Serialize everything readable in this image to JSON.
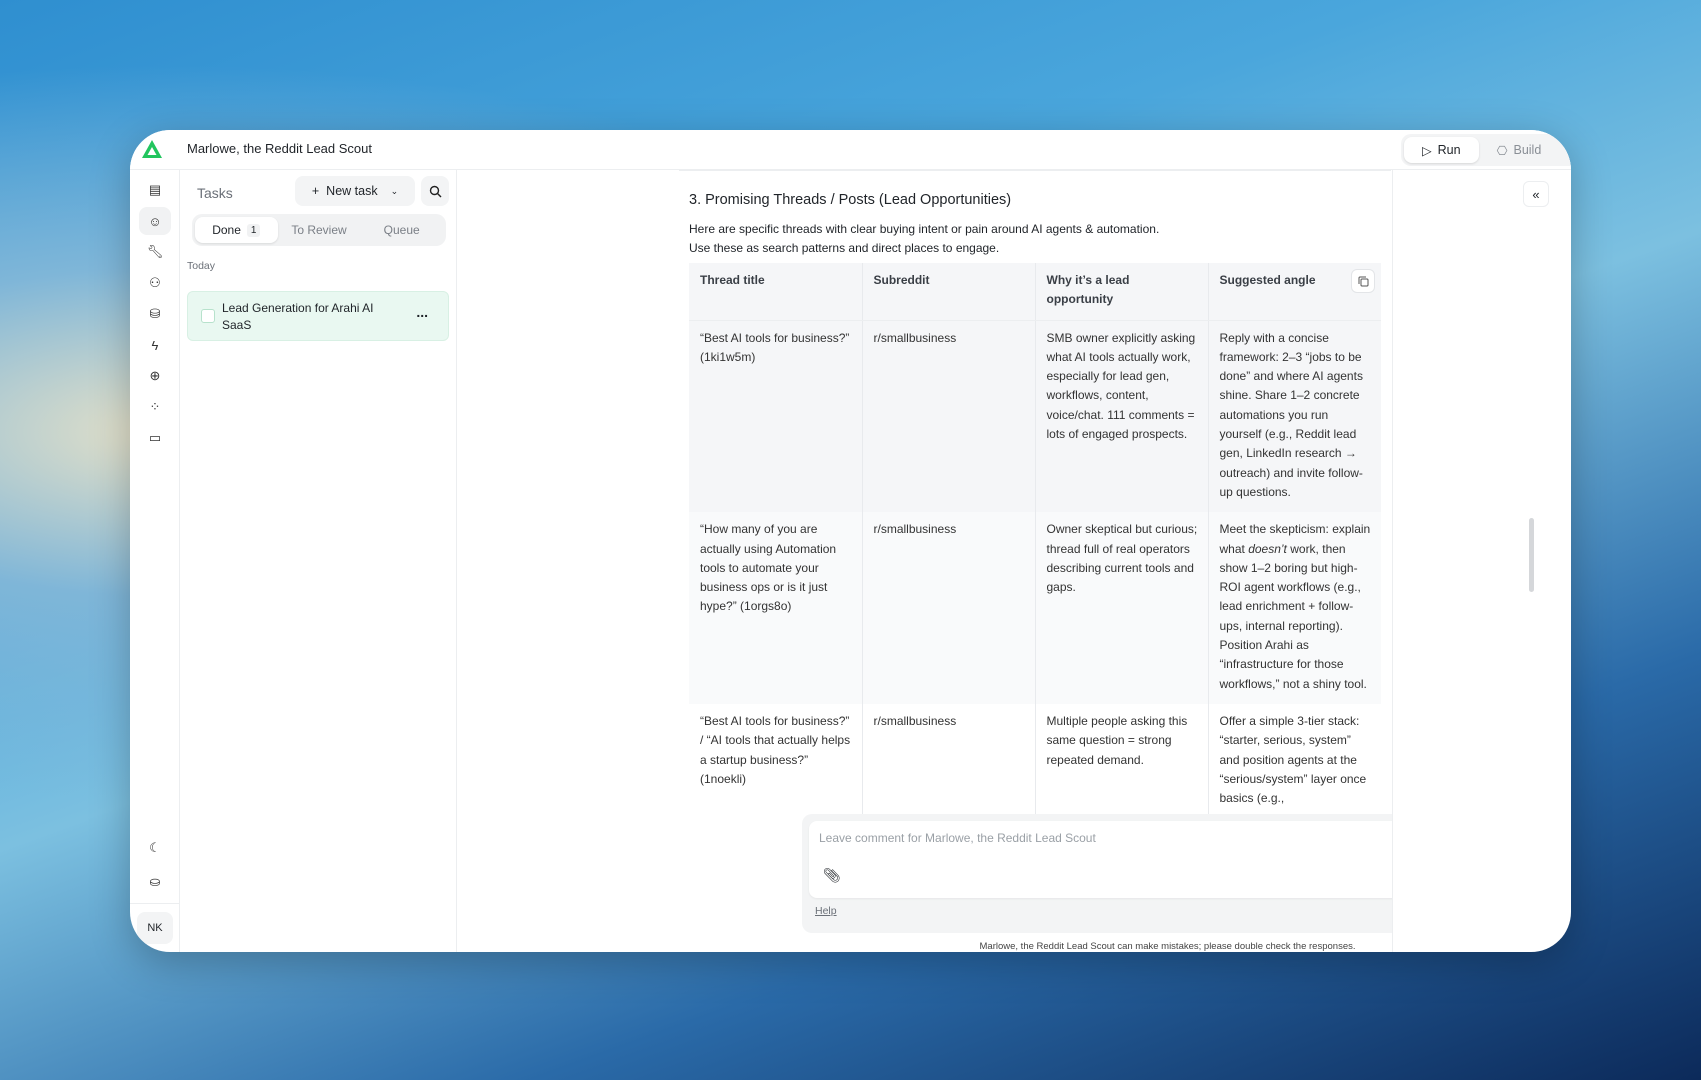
{
  "header": {
    "title": "Marlowe, the Reddit Lead Scout",
    "modes": [
      {
        "label": "Run",
        "icon": "play-icon"
      },
      {
        "label": "Build",
        "icon": "hexagon-icon"
      }
    ]
  },
  "colors": {
    "brand": "#22c55e",
    "task_bg": "#e9f8f1"
  },
  "rail": {
    "items": [
      "dashboard-icon",
      "agent-icon",
      "wrench-icon",
      "users-icon",
      "database-icon",
      "lightning-icon",
      "globe-icon",
      "apps-icon",
      "book-icon"
    ],
    "bottom": [
      "moon-icon",
      "coins-icon"
    ],
    "avatar": "NK"
  },
  "tasks": {
    "label": "Tasks",
    "new_task": "New task",
    "tabs": [
      {
        "label": "Done",
        "count": "1"
      },
      {
        "label": "To Review"
      },
      {
        "label": "Queue"
      }
    ],
    "group": "Today",
    "items": [
      {
        "title": "Lead Generation for Arahi AI SaaS",
        "menu": "..."
      }
    ]
  },
  "article": {
    "heading": "3. Promising Threads / Posts (Lead Opportunities)",
    "intro": [
      "Here are specific threads with clear buying intent or pain around AI agents & automation.",
      "Use these as search patterns and direct places to engage."
    ],
    "table": {
      "headers": [
        "Thread title",
        "Subreddit",
        "Why it’s a lead opportunity",
        "Suggested angle"
      ],
      "rows": [
        [
          "“Best AI tools for business?” (1ki1w5m)",
          "r/smallbusiness",
          "SMB owner explicitly asking what AI tools actually work, especially for lead gen, workflows, content, voice/chat. 111 comments = lots of engaged prospects.",
          "Reply with a concise framework: 2–3 “jobs to be done” and where AI agents shine. Share 1–2 concrete automations you run yourself (e.g., Reddit lead gen, LinkedIn research → outreach) and invite follow-up questions."
        ],
        [
          "“How many of you are actually using Automation tools to automate your business ops or is it just hype?” (1orgs8o)",
          "r/smallbusiness",
          "Owner skeptical but curious; thread full of real operators describing current tools and gaps.",
          "Meet the skepticism: explain what doesn’t work, then show 1–2 boring but high-ROI agent workflows (e.g., lead enrichment + follow-ups, internal reporting). Position Arahi as “infrastructure for those workflows,” not a shiny tool."
        ],
        [
          "“Best AI tools for business?” / “AI tools that actually helps a startup business?” (1noekli)",
          "r/smallbusiness",
          "Multiple people asking this same question = strong repeated demand.",
          "Offer a simple 3-tier stack: “starter, serious, system” and position agents at the “serious/system” layer once basics (e.g.,"
        ]
      ]
    }
  },
  "composer": {
    "placeholder": "Leave comment for Marlowe, the Reddit Lead Scout",
    "help": "Help",
    "disclaimer": "Marlowe, the Reddit Lead Scout can make mistakes; please double check the responses."
  },
  "panel": {
    "collapse": "«"
  }
}
